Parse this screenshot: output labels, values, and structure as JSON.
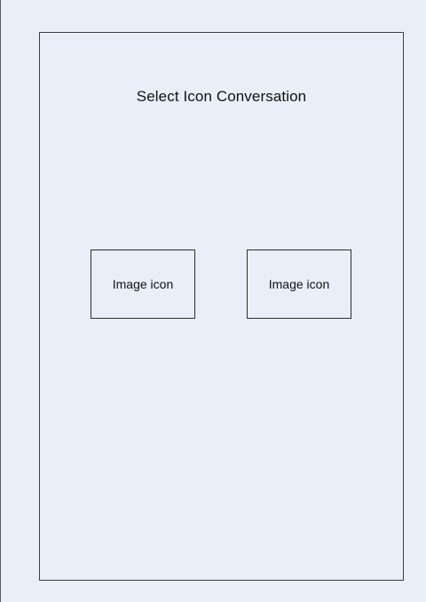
{
  "screen": {
    "title": "Select Icon Conversation"
  },
  "icons": [
    {
      "label": "Image icon"
    },
    {
      "label": "Image icon"
    }
  ]
}
